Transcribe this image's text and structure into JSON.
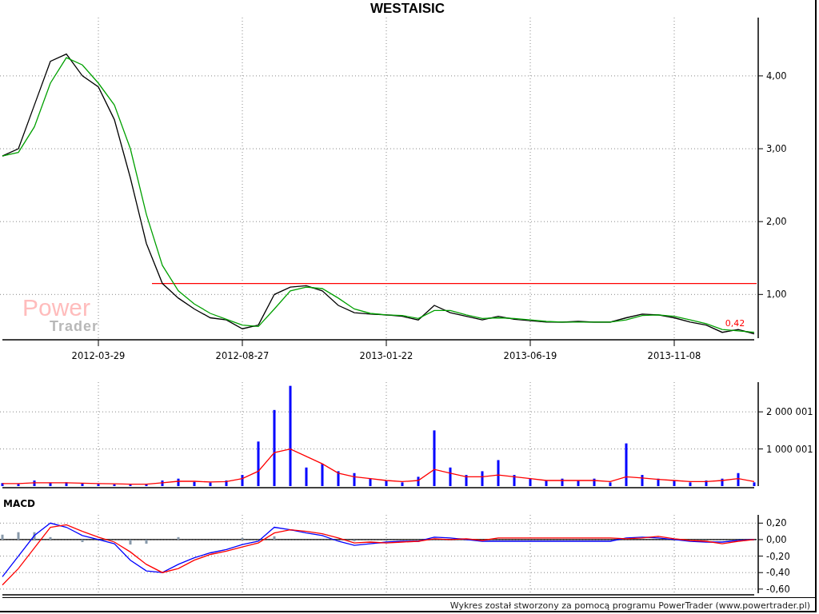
{
  "title": "WESTAISIC",
  "watermark_logo": {
    "line_1": "Power",
    "line_2": "Trader"
  },
  "price_panel": {
    "chart_data": {
      "type": "line",
      "grid": true,
      "ylim": [
        0.4,
        4.8
      ],
      "categories": [
        null,
        null,
        null,
        null,
        null,
        null,
        "2012-03-29",
        null,
        null,
        null,
        null,
        null,
        null,
        null,
        null,
        "2012-08-27",
        null,
        null,
        null,
        null,
        null,
        null,
        null,
        null,
        "2013-01-22",
        null,
        null,
        null,
        null,
        null,
        null,
        null,
        null,
        "2013-06-19",
        null,
        null,
        null,
        null,
        null,
        null,
        null,
        null,
        "2013-11-08",
        null,
        null,
        null,
        null,
        null
      ],
      "yticks": [
        {
          "value": 1,
          "label": "1,00"
        },
        {
          "value": 2,
          "label": "2,00"
        },
        {
          "value": 3,
          "label": "3,00"
        },
        {
          "value": 4,
          "label": "4,00"
        }
      ],
      "series": [
        {
          "color": "#000000",
          "values": [
            2.9,
            3.0,
            3.6,
            4.2,
            4.3,
            4.0,
            3.85,
            3.4,
            2.6,
            1.7,
            1.15,
            0.95,
            0.8,
            0.68,
            0.65,
            0.53,
            0.58,
            1.0,
            1.1,
            1.12,
            1.05,
            0.85,
            0.75,
            0.73,
            0.72,
            0.7,
            0.65,
            0.85,
            0.75,
            0.7,
            0.65,
            0.7,
            0.66,
            0.64,
            0.62,
            0.62,
            0.63,
            0.62,
            0.62,
            0.68,
            0.73,
            0.72,
            0.68,
            0.62,
            0.58,
            0.48,
            0.52,
            0.46
          ]
        },
        {
          "color": "#00a000",
          "values": [
            2.9,
            2.95,
            3.3,
            3.9,
            4.25,
            4.15,
            3.9,
            3.6,
            3.0,
            2.1,
            1.4,
            1.05,
            0.87,
            0.74,
            0.66,
            0.58,
            0.56,
            0.8,
            1.05,
            1.1,
            1.08,
            0.95,
            0.8,
            0.74,
            0.72,
            0.71,
            0.67,
            0.78,
            0.78,
            0.72,
            0.67,
            0.68,
            0.67,
            0.65,
            0.63,
            0.62,
            0.62,
            0.62,
            0.62,
            0.65,
            0.71,
            0.72,
            0.7,
            0.65,
            0.6,
            0.52,
            0.5,
            0.48
          ]
        }
      ],
      "ref_lines": [
        {
          "axis": "y",
          "value": 1.15,
          "color": "#ff0000"
        }
      ],
      "annotations": [
        {
          "y": 0.56,
          "text": "0,42"
        }
      ]
    }
  },
  "volume_panel": {
    "chart_data": {
      "type": "bar",
      "grid": true,
      "ylim": [
        0,
        2800000
      ],
      "yticks": [
        {
          "value": 1000001,
          "label": "1 000 001"
        },
        {
          "value": 2000001,
          "label": "2 000 001"
        }
      ],
      "series": [
        {
          "color": "#0000ff",
          "values": [
            80000,
            60000,
            150000,
            90000,
            100000,
            70000,
            60000,
            50000,
            40000,
            50000,
            150000,
            200000,
            120000,
            100000,
            150000,
            300000,
            1200000,
            2050000,
            2700000,
            500000,
            600000,
            400000,
            350000,
            200000,
            150000,
            100000,
            250000,
            1500000,
            500000,
            300000,
            400000,
            700000,
            300000,
            200000,
            150000,
            200000,
            150000,
            200000,
            100000,
            1150000,
            300000,
            200000,
            150000,
            100000,
            150000,
            200000,
            350000,
            100000
          ]
        },
        {
          "type": "line",
          "color": "#ff0000",
          "values": [
            70000,
            70000,
            90000,
            90000,
            90000,
            80000,
            70000,
            60000,
            50000,
            50000,
            90000,
            130000,
            130000,
            110000,
            120000,
            200000,
            400000,
            900000,
            1000000,
            800000,
            600000,
            350000,
            250000,
            200000,
            150000,
            120000,
            150000,
            450000,
            350000,
            250000,
            250000,
            300000,
            250000,
            200000,
            150000,
            150000,
            150000,
            150000,
            120000,
            250000,
            220000,
            180000,
            150000,
            120000,
            120000,
            150000,
            200000,
            120000
          ]
        }
      ]
    }
  },
  "macd_panel": {
    "label": "MACD",
    "chart_data": {
      "type": "line",
      "grid": true,
      "ylim": [
        -0.65,
        0.3
      ],
      "yticks": [
        {
          "value": 0.2,
          "label": "0,20"
        },
        {
          "value": 0,
          "label": "0,00"
        },
        {
          "value": -0.2,
          "label": "-0,20"
        },
        {
          "value": -0.4,
          "label": "-0,40"
        },
        {
          "value": -0.6,
          "label": "-0,60"
        }
      ],
      "series": [
        {
          "type": "bar",
          "color": "#8899aa",
          "values": [
            0.06,
            0.09,
            0.09,
            0.03,
            0.0,
            -0.03,
            0.0,
            0.0,
            -0.06,
            -0.05,
            0.0,
            0.03,
            0.0,
            0.0,
            0.0,
            0.02,
            0.0,
            0.04,
            0.0,
            0.0,
            0.0,
            0.0,
            -0.02,
            0.0,
            0.0,
            0.0,
            0.0,
            0.0,
            0.0,
            0.0,
            0.0,
            0.0,
            0.0,
            0.0,
            0.0,
            0.0,
            0.0,
            0.0,
            0.0,
            0.0,
            0.0,
            0.0,
            0.0,
            0.0,
            0.0,
            0.0,
            0.0,
            0.0
          ]
        },
        {
          "color": "#0000ff",
          "values": [
            -0.45,
            -0.2,
            0.05,
            0.2,
            0.15,
            0.05,
            0.0,
            -0.05,
            -0.25,
            -0.38,
            -0.4,
            -0.3,
            -0.22,
            -0.16,
            -0.12,
            -0.06,
            -0.02,
            0.15,
            0.12,
            0.08,
            0.05,
            -0.02,
            -0.07,
            -0.05,
            -0.03,
            -0.02,
            -0.02,
            0.03,
            0.02,
            0.0,
            -0.02,
            -0.02,
            -0.02,
            -0.02,
            -0.02,
            -0.02,
            -0.02,
            -0.02,
            -0.02,
            0.02,
            0.03,
            0.02,
            0.0,
            -0.02,
            -0.03,
            -0.03,
            -0.01,
            0.0
          ]
        },
        {
          "color": "#ff0000",
          "values": [
            -0.55,
            -0.35,
            -0.1,
            0.15,
            0.18,
            0.1,
            0.03,
            -0.03,
            -0.15,
            -0.3,
            -0.4,
            -0.35,
            -0.25,
            -0.18,
            -0.14,
            -0.09,
            -0.04,
            0.08,
            0.12,
            0.1,
            0.07,
            0.02,
            -0.04,
            -0.03,
            -0.04,
            -0.03,
            -0.02,
            0.01,
            0.0,
            0.01,
            -0.01,
            0.02,
            0.02,
            0.02,
            0.02,
            0.02,
            0.02,
            0.02,
            0.02,
            0.01,
            0.02,
            0.04,
            0.01,
            -0.01,
            -0.02,
            -0.05,
            -0.02,
            0.0
          ]
        }
      ],
      "ref_lines": [
        {
          "axis": "y",
          "value": 0,
          "color": "#000000"
        }
      ]
    }
  },
  "footer": "Wykres został stworzony za pomocą programu PowerTrader (www.powertrader.pl)"
}
